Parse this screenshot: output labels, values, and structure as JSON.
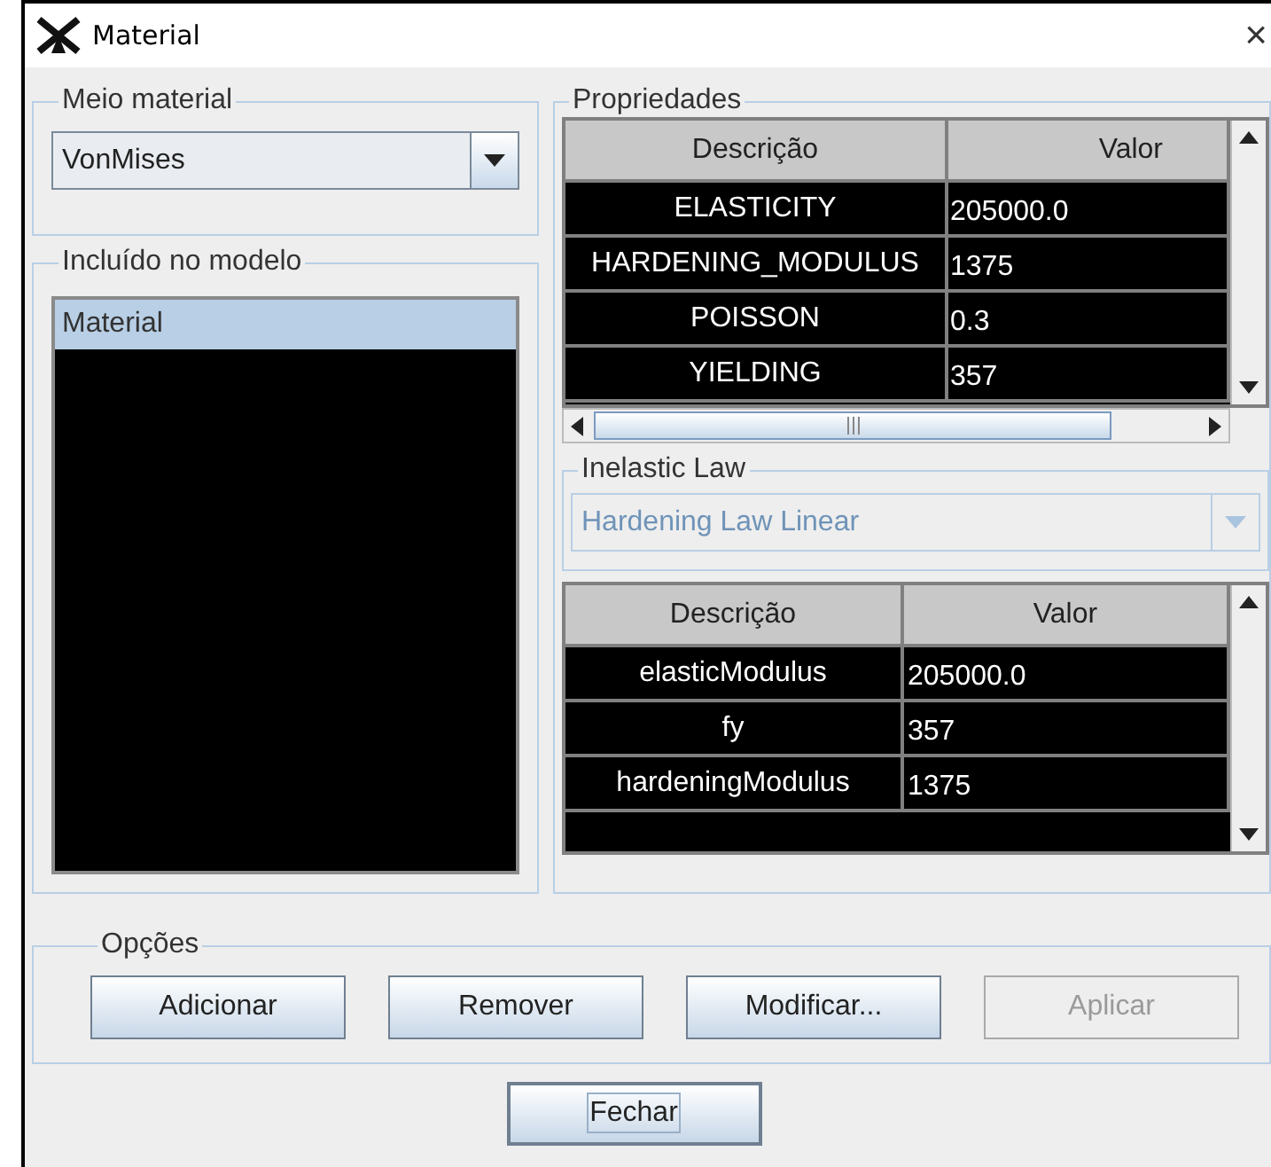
{
  "window": {
    "title": "Material",
    "close": "×"
  },
  "meio_material": {
    "legend": "Meio material",
    "value": "VonMises"
  },
  "incluido": {
    "legend": "Incluído no modelo",
    "items": [
      {
        "label": "Material",
        "selected": true
      }
    ]
  },
  "propriedades": {
    "legend": "Propriedades",
    "columns": [
      "Descrição",
      "Valor"
    ],
    "rows": [
      [
        "ELASTICITY",
        "205000.0"
      ],
      [
        "HARDENING_MODULUS",
        "1375"
      ],
      [
        "POISSON",
        "0.3"
      ],
      [
        "YIELDING",
        "357"
      ]
    ]
  },
  "inelastic_law": {
    "legend": "Inelastic Law",
    "value": "Hardening Law Linear",
    "disabled": true,
    "columns": [
      "Descrição",
      "Valor"
    ],
    "rows": [
      [
        "elasticModulus",
        "205000.0"
      ],
      [
        "fy",
        "357"
      ],
      [
        "hardeningModulus",
        "1375"
      ]
    ]
  },
  "opcoes": {
    "legend": "Opções",
    "buttons": [
      {
        "label": "Adicionar",
        "disabled": false
      },
      {
        "label": "Remover",
        "disabled": false
      },
      {
        "label": "Modificar...",
        "disabled": false
      },
      {
        "label": "Aplicar",
        "disabled": true
      }
    ]
  },
  "close_button": {
    "label": "Fechar"
  }
}
